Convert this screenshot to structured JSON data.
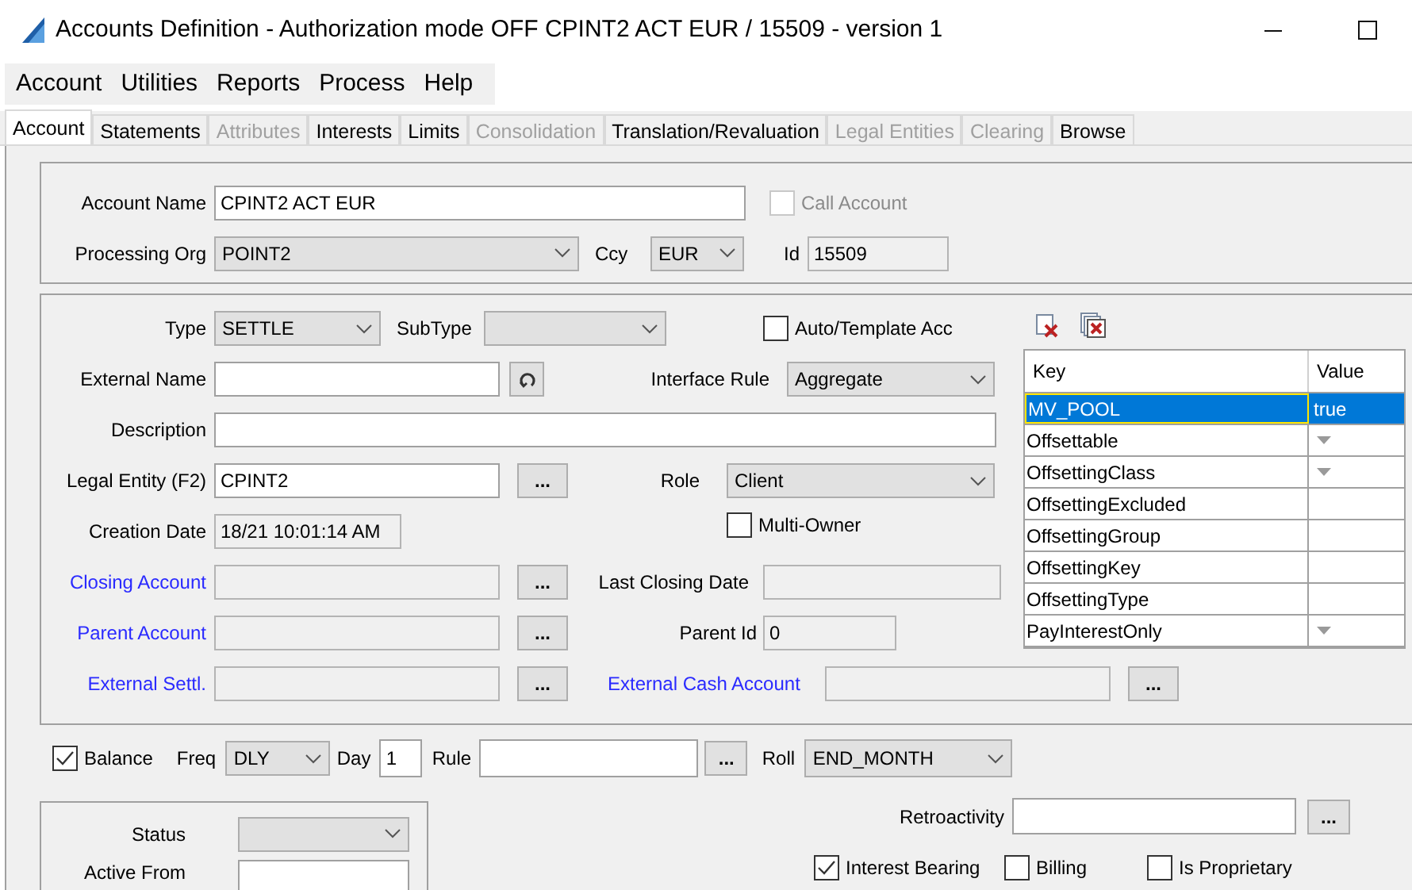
{
  "window": {
    "title": "Accounts Definition - Authorization mode OFF CPINT2 ACT EUR / 15509 - version 1"
  },
  "menu": [
    "Account",
    "Utilities",
    "Reports",
    "Process",
    "Help"
  ],
  "tabs": [
    {
      "label": "Account",
      "selected": true,
      "disabled": false
    },
    {
      "label": "Statements",
      "selected": false,
      "disabled": false
    },
    {
      "label": "Attributes",
      "selected": false,
      "disabled": true
    },
    {
      "label": "Interests",
      "selected": false,
      "disabled": false
    },
    {
      "label": "Limits",
      "selected": false,
      "disabled": false
    },
    {
      "label": "Consolidation",
      "selected": false,
      "disabled": true
    },
    {
      "label": "Translation/Revaluation",
      "selected": false,
      "disabled": false
    },
    {
      "label": "Legal Entities",
      "selected": false,
      "disabled": true
    },
    {
      "label": "Clearing",
      "selected": false,
      "disabled": true
    },
    {
      "label": "Browse",
      "selected": false,
      "disabled": false
    }
  ],
  "account": {
    "name": {
      "label": "Account Name",
      "value": "CPINT2 ACT EUR",
      "disabled": false
    },
    "call_account": {
      "label": "Call Account",
      "checked": false,
      "disabled": true
    },
    "processing_org": {
      "label": "Processing Org",
      "value": "POINT2"
    },
    "ccy": {
      "label": "Ccy",
      "value": "EUR"
    },
    "id": {
      "label": "Id",
      "value": "15509",
      "disabled": true
    }
  },
  "details": {
    "type": {
      "label": "Type",
      "value": "SETTLE"
    },
    "subtype": {
      "label": "SubType"
    },
    "auto_template": {
      "label": "Auto/Template Acc",
      "checked": false,
      "disabled": false
    },
    "external_name": {
      "label": "External Name",
      "link": false,
      "disabled": false
    },
    "interface_rule": {
      "label": "Interface Rule",
      "value": "Aggregate"
    },
    "description": {
      "label": "Description",
      "link": false,
      "disabled": false
    },
    "legal_entity": {
      "label": "Legal Entity (F2)",
      "link": false,
      "value": "CPINT2",
      "disabled": false,
      "button": "..."
    },
    "role": {
      "label": "Role",
      "value": "Client"
    },
    "multi_owner": {
      "label": "Multi-Owner",
      "checked": false,
      "disabled": false
    },
    "creation_date": {
      "label": "Creation Date",
      "link": false,
      "value": "18/21 10:01:14 AM",
      "disabled": true
    },
    "closing_account": {
      "label": "Closing Account",
      "link": true,
      "disabled": true,
      "button": "..."
    },
    "last_closing_date": {
      "label": "Last Closing Date",
      "link": false,
      "disabled": true
    },
    "parent_account": {
      "label": "Parent Account",
      "link": true,
      "disabled": true,
      "button": "..."
    },
    "parent_id": {
      "label": "Parent Id",
      "link": false,
      "value": "0",
      "disabled": true
    },
    "external_settl": {
      "label": "External Settl.",
      "link": true,
      "disabled": true,
      "button": "..."
    },
    "external_cash_account": {
      "label": "External Cash Account",
      "link": true,
      "disabled": true,
      "button": "..."
    }
  },
  "attributes": {
    "columns": [
      "Key",
      "Value"
    ],
    "rows": [
      {
        "key": "MV_POOL",
        "value": "true",
        "selected": true,
        "dropdown": false
      },
      {
        "key": "Offsettable",
        "selected": false,
        "dropdown": true
      },
      {
        "key": "OffsettingClass",
        "selected": false,
        "dropdown": true
      },
      {
        "key": "OffsettingExcluded",
        "selected": false,
        "dropdown": false
      },
      {
        "key": "OffsettingGroup",
        "selected": false,
        "dropdown": false
      },
      {
        "key": "OffsettingKey",
        "selected": false,
        "dropdown": false
      },
      {
        "key": "OffsettingType",
        "selected": false,
        "dropdown": false
      },
      {
        "key": "PayInterestOnly",
        "selected": false,
        "dropdown": true
      }
    ]
  },
  "balance": {
    "balance": {
      "label": "Balance",
      "checked": true,
      "disabled": false
    },
    "freq": {
      "label": "Freq",
      "value": "DLY"
    },
    "day": {
      "label": "Day",
      "value": "1",
      "disabled": false
    },
    "rule": {
      "label": "Rule",
      "disabled": false,
      "button": "..."
    },
    "roll": {
      "label": "Roll",
      "value": "END_MONTH"
    }
  },
  "status": {
    "status": {
      "label": "Status"
    },
    "active_from": {
      "label": "Active From",
      "disabled": false
    }
  },
  "retroactivity": {
    "label": "Retroactivity",
    "disabled": false,
    "button": "..."
  },
  "flags": [
    {
      "label": "Interest Bearing",
      "checked": true,
      "disabled": false
    },
    {
      "label": "Billing",
      "checked": false,
      "disabled": false
    },
    {
      "label": "Is Proprietary",
      "checked": false,
      "disabled": false
    }
  ]
}
